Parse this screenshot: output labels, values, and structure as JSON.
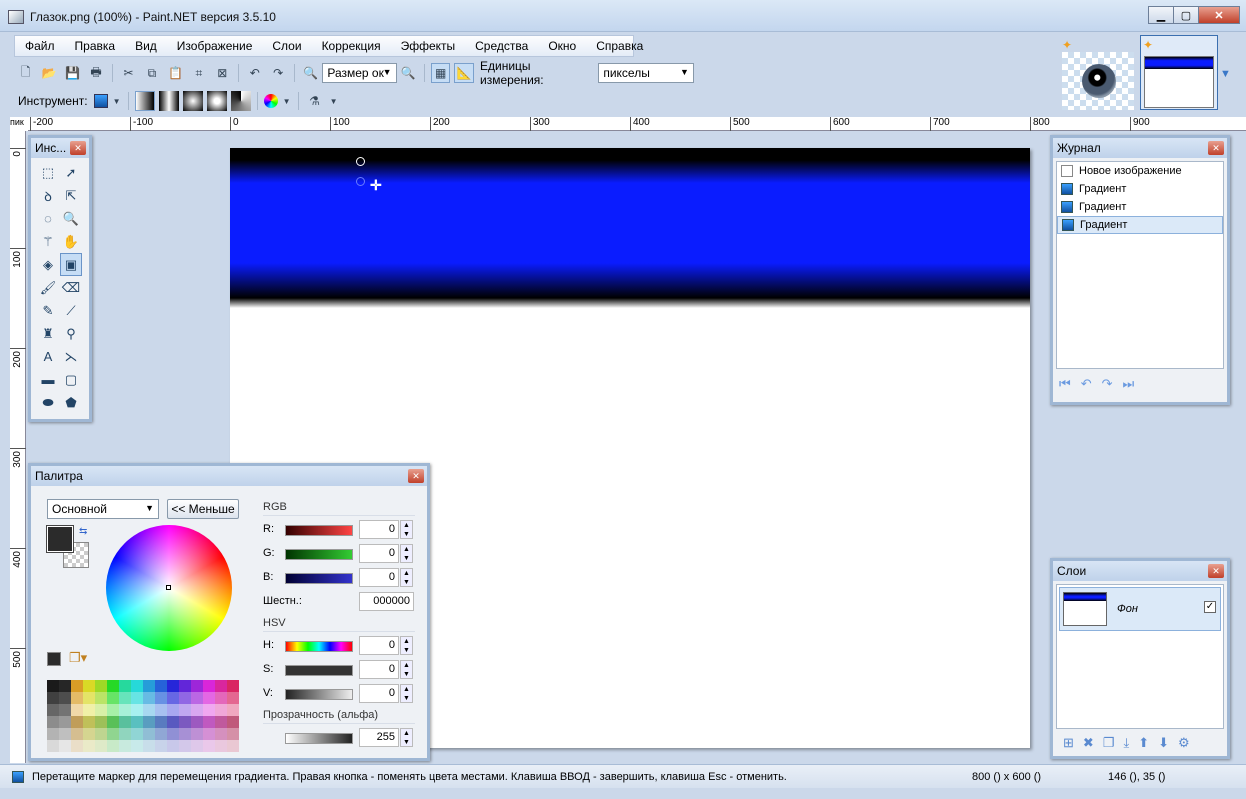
{
  "window": {
    "title": "Глазок.png (100%) - Paint.NET версия 3.5.10",
    "min": "▁",
    "max": "▢",
    "close": "✕"
  },
  "menu": [
    "Файл",
    "Правка",
    "Вид",
    "Изображение",
    "Слои",
    "Коррекция",
    "Эффекты",
    "Средства",
    "Окно",
    "Справка"
  ],
  "toolbar": {
    "zoom_value": "Размер ок",
    "units_label": "Единицы измерения:",
    "units_value": "пикселы",
    "tool_label": "Инструмент:"
  },
  "ruler": {
    "corner": "пик",
    "h_labels": [
      "-200",
      "-100",
      "0",
      "100",
      "200",
      "300",
      "400",
      "500",
      "600",
      "700",
      "800",
      "900"
    ],
    "v_labels": [
      "0",
      "100",
      "200",
      "300",
      "400",
      "500"
    ]
  },
  "tools_window": {
    "title": "Инс..."
  },
  "history_window": {
    "title": "Журнал",
    "items": [
      "Новое изображение",
      "Градиент",
      "Градиент",
      "Градиент"
    ],
    "selected_index": 3
  },
  "layers_window": {
    "title": "Слои",
    "layer_name": "Фон",
    "layer_visible": true
  },
  "palette_window": {
    "title": "Палитра",
    "mode": "Основной",
    "less_button": "<< Меньше",
    "rgb_label": "RGB",
    "r_label": "R:",
    "r_value": "0",
    "g_label": "G:",
    "g_value": "0",
    "b_label": "B:",
    "b_value": "0",
    "hex_label": "Шестн.:",
    "hex_value": "000000",
    "hsv_label": "HSV",
    "h_label": "H:",
    "h_value": "0",
    "s_label": "S:",
    "s_value": "0",
    "v_label": "V:",
    "v_value": "0",
    "alpha_label": "Прозрачность (альфа)",
    "alpha_value": "255"
  },
  "status": {
    "message": "Перетащите маркер для перемещения градиента. Правая кнопка - поменять цвета местами. Клавиша ВВОД - завершить, клавиша Esc - отменить.",
    "image_size": "800 () x 600 ()",
    "cursor_pos": "146 (), 35 ()"
  },
  "colors": {
    "gradient_blue": "#0a1cff",
    "primary": "#2b2b2b",
    "chrome": "#cbd8ea"
  }
}
